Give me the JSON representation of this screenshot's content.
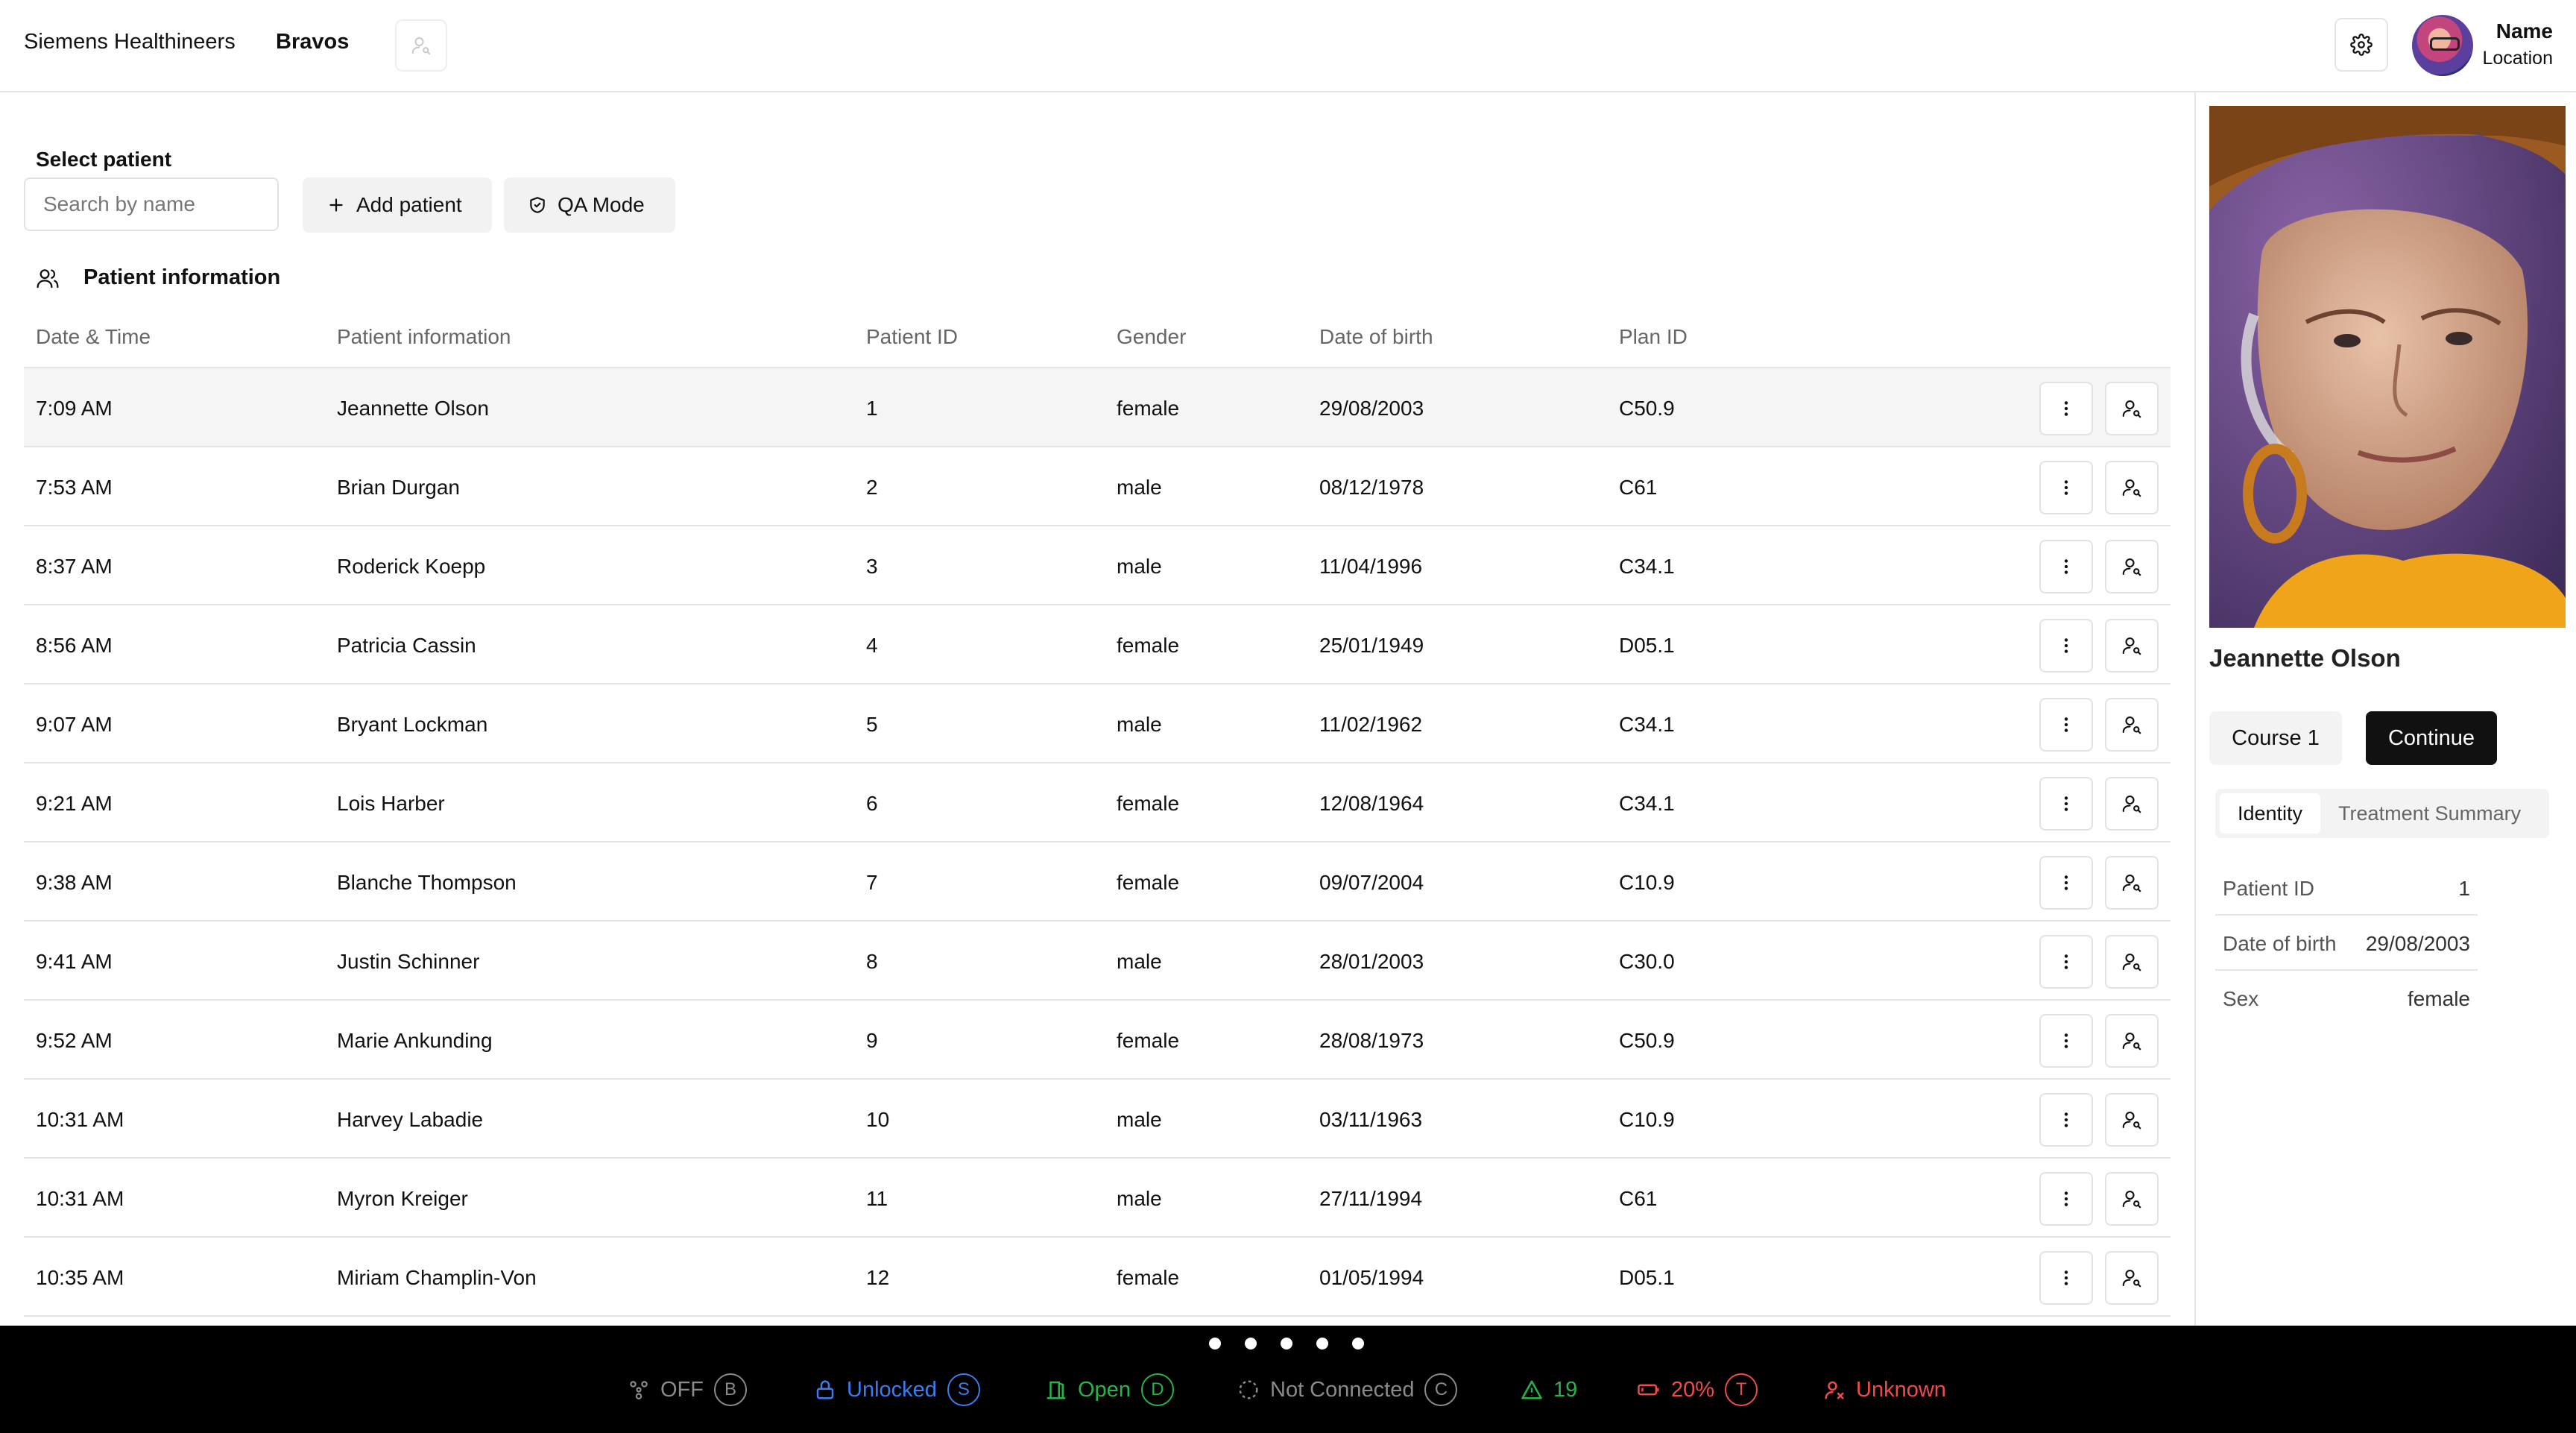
{
  "header": {
    "brand": "Siemens Healthineers",
    "product": "Bravos",
    "user_name": "Name",
    "user_location": "Location"
  },
  "patient_select": {
    "label": "Select patient",
    "search_placeholder": "Search by name",
    "add_label": "Add patient",
    "qa_label": "QA Mode"
  },
  "section": {
    "title": "Patient information"
  },
  "table": {
    "columns": [
      "Date & Time",
      "Patient information",
      "Patient ID",
      "Gender",
      "Date of birth",
      "Plan ID"
    ],
    "rows": [
      {
        "time": "7:09 AM",
        "name": "Jeannette Olson",
        "id": "1",
        "gender": "female",
        "dob": "29/08/2003",
        "plan": "C50.9"
      },
      {
        "time": "7:53 AM",
        "name": "Brian Durgan",
        "id": "2",
        "gender": "male",
        "dob": "08/12/1978",
        "plan": "C61"
      },
      {
        "time": "8:37 AM",
        "name": "Roderick Koepp",
        "id": "3",
        "gender": "male",
        "dob": "11/04/1996",
        "plan": "C34.1"
      },
      {
        "time": "8:56 AM",
        "name": "Patricia Cassin",
        "id": "4",
        "gender": "female",
        "dob": "25/01/1949",
        "plan": "D05.1"
      },
      {
        "time": "9:07 AM",
        "name": "Bryant Lockman",
        "id": "5",
        "gender": "male",
        "dob": "11/02/1962",
        "plan": "C34.1"
      },
      {
        "time": "9:21 AM",
        "name": "Lois Harber",
        "id": "6",
        "gender": "female",
        "dob": "12/08/1964",
        "plan": "C34.1"
      },
      {
        "time": "9:38 AM",
        "name": "Blanche Thompson",
        "id": "7",
        "gender": "female",
        "dob": "09/07/2004",
        "plan": "C10.9"
      },
      {
        "time": "9:41 AM",
        "name": "Justin Schinner",
        "id": "8",
        "gender": "male",
        "dob": "28/01/2003",
        "plan": "C30.0"
      },
      {
        "time": "9:52 AM",
        "name": "Marie Ankunding",
        "id": "9",
        "gender": "female",
        "dob": "28/08/1973",
        "plan": "C50.9"
      },
      {
        "time": "10:31 AM",
        "name": "Harvey Labadie",
        "id": "10",
        "gender": "male",
        "dob": "03/11/1963",
        "plan": "C10.9"
      },
      {
        "time": "10:31 AM",
        "name": "Myron Kreiger",
        "id": "11",
        "gender": "male",
        "dob": "27/11/1994",
        "plan": "C61"
      },
      {
        "time": "10:35 AM",
        "name": "Miriam Champlin-Von",
        "id": "12",
        "gender": "female",
        "dob": "01/05/1994",
        "plan": "D05.1"
      }
    ]
  },
  "selected_patient": {
    "name": "Jeannette Olson",
    "course_label": "Course 1",
    "continue_label": "Continue",
    "tabs": [
      "Identity",
      "Treatment Summary"
    ],
    "active_tab": "Identity",
    "identity": [
      {
        "key": "Patient ID",
        "value": "1"
      },
      {
        "key": "Date of birth",
        "value": "29/08/2003"
      },
      {
        "key": "Sex",
        "value": "female"
      }
    ]
  },
  "status_bar": {
    "page_count": 5,
    "items": [
      {
        "label": "OFF",
        "key": "B",
        "color": "#8a8a8a",
        "icon": "beam-icon"
      },
      {
        "label": "Unlocked",
        "key": "S",
        "color": "#3b7df0",
        "icon": "lock-open-icon"
      },
      {
        "label": "Open",
        "key": "D",
        "color": "#26b34a",
        "icon": "door-icon"
      },
      {
        "label": "Not Connected",
        "key": "C",
        "color": "#8a8a8a",
        "icon": "connection-icon"
      },
      {
        "label": "19",
        "key": "",
        "color": "#26b34a",
        "icon": "warning-icon"
      },
      {
        "label": "20%",
        "key": "T",
        "color": "#f04b4b",
        "icon": "battery-icon"
      },
      {
        "label": "Unknown",
        "key": "",
        "color": "#f04b4b",
        "icon": "user-x-icon"
      }
    ]
  },
  "colors": {
    "accent_dark": "#111111",
    "status_bg": "#000000",
    "selected_row_bg": "#f5f5f5"
  }
}
